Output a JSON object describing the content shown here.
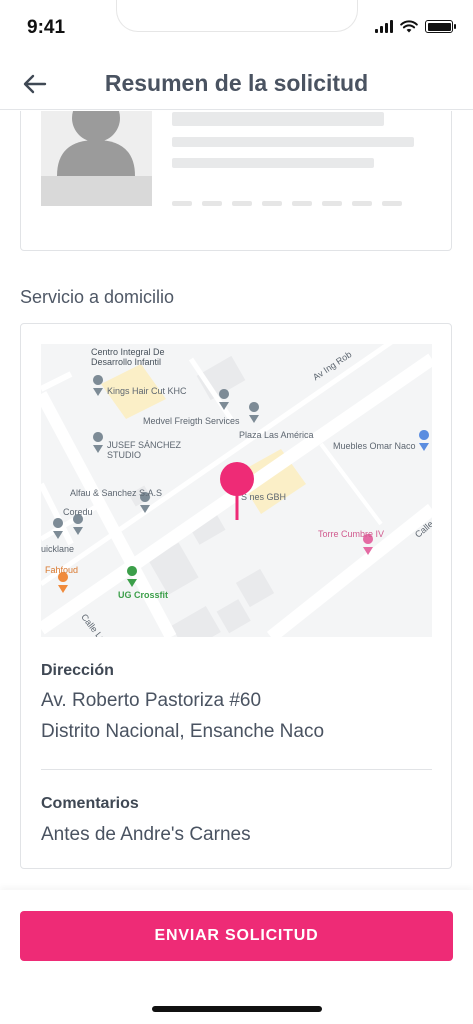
{
  "status_bar": {
    "time": "9:41"
  },
  "header": {
    "title": "Resumen de la solicitud",
    "back_icon": "arrow-left-icon"
  },
  "section": {
    "label": "Servicio a domicilio"
  },
  "map": {
    "labels": {
      "centro": "Centro Integral De",
      "desarrollo": "Desarrollo Infantil",
      "kings": "Kings Hair Cut KHC",
      "medvel": "Medvel Freigth Services",
      "plaza": "Plaza Las América",
      "muebles": "Muebles Omar Naco",
      "jusef1": "JUSEF SÁNCHEZ",
      "jusef2": "STUDIO",
      "alfau": "Alfau & Sanchez S.A.S",
      "coredu": "Coredu",
      "uicklane": "uicklane",
      "fahfoud": "Fahfoud",
      "ug": "UG Crossfit",
      "calle_luis": "Calle Luis",
      "torre": "Torre Cumbre IV",
      "av_ing": "Av Ing Rob",
      "calle": "Calle C",
      "gbh": "S     nes GBH"
    },
    "pin_color": "#ee2b76"
  },
  "address": {
    "title": "Dirección",
    "line1": "Av. Roberto Pastoriza #60",
    "line2": "Distrito Nacional, Ensanche Naco"
  },
  "comments": {
    "title": "Comentarios",
    "text": "Antes de Andre's Carnes"
  },
  "footer": {
    "button_label": "ENVIAR SOLICITUD",
    "accent": "#ee2b76"
  }
}
